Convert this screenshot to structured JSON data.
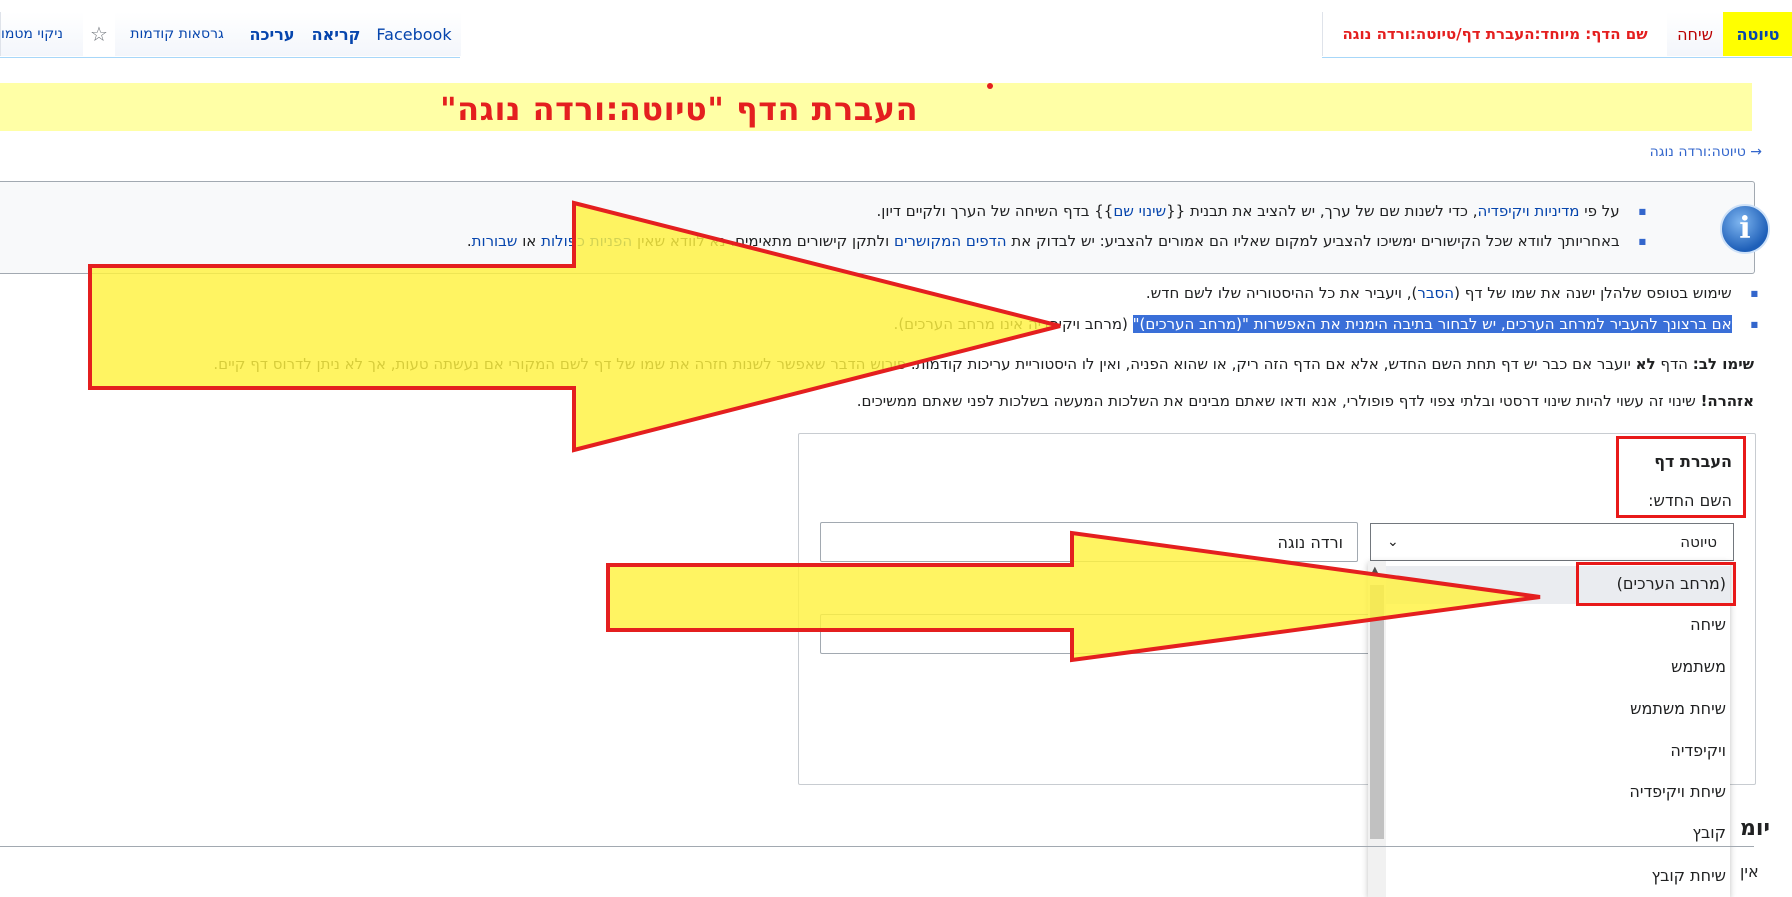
{
  "tabs": {
    "draft": "טיוטה",
    "talk": "שיחה",
    "page_name": "שם הדף: מיוחד:העברת דף/טיוטה:ורדה נוגה",
    "facebook": "Facebook",
    "read": "קריאה",
    "edit": "עריכה",
    "history": "גרסאות קודמות",
    "purge": "ניקוי מטמו"
  },
  "banner": {
    "title": "העברת הדף \"טיוטה:ורדה נוגה\""
  },
  "backlink": "→ טיוטה:ורדה נוגה",
  "info": {
    "line1_a": "על פי ",
    "line1_link": "מדיניות ויקיפדיה",
    "line1_b": ", כדי לשנות שם של ערך, יש להציב את תבנית {{",
    "line1_link2": "שינוי שם",
    "line1_c": "}} בדף השיחה של הערך ולקיים דיון.",
    "line2_a": "באחריותך לוודא שכל הקישורים ימשיכו להצביע למקום שאליו הם אמורים להצביע: יש לבדוק את ",
    "line2_link": "הדפים המקושרים",
    "line2_b": " ולתקן קישורים מתאימים. נא לוודא שאין ",
    "line2_link2": "הפניות כפולות",
    "line2_c": " או ",
    "line2_link3": "שבורות",
    "line2_d": "."
  },
  "bullets": {
    "b1_a": "שימוש בטופס שלהלן ישנה את שמו של דף (",
    "b1_link": "הסבר",
    "b1_b": "), ויעביר את כל ההיסטוריה שלו לשם חדש.",
    "b2_selected": "אם ברצונך להעביר למרחב הערכים, יש לבחור בתיבה הימנית את האפשרות \"(מרחב הערכים)\"",
    "b2_rest": " (מרחב ויקיפדיה אינו מרחב הערכים)."
  },
  "notes": {
    "note_label": "שימו לב:",
    "note_a": " הדף ",
    "note_bold": "לא",
    "note_b": " יועבר אם כבר יש דף תחת השם החדש, אלא אם הדף הזה ריק, או שהוא הפניה, ואין לו היסטוריית עריכות קודמות. פירוש הדבר שאפשר לשנות חזרה את שמו של דף לשם המקורי אם נעשתה טעות, אך לא ניתן לדרוס דף קיים.",
    "warn_label": "אזהרה!",
    "warn_text": " שינוי זה עשוי להיות שינוי דרסטי ובלתי צפוי לדף פופולרי, אנא ודאו שאתם מבינים את השלכות המעשה בשלכות לפני שאתם ממשיכים."
  },
  "form": {
    "legend": "העברת דף",
    "new_name_label": "השם החדש:",
    "namespace_value": "טיוטה",
    "title_value": "ורדה נוגה",
    "dropdown": [
      "(מרחב הערכים)",
      "שיחה",
      "משתמש",
      "שיחת משתמש",
      "ויקיפדיה",
      "שיחת ויקיפדיה",
      "קובץ",
      "שיחת קובץ"
    ]
  },
  "section": {
    "heading_fragment": "יומ",
    "text_fragment": "אין"
  },
  "colors": {
    "highlight": "#ffffa6",
    "arrow_fill": "#fff23f",
    "arrow_stroke": "#e41f1f",
    "selection": "#3a6fd8"
  }
}
